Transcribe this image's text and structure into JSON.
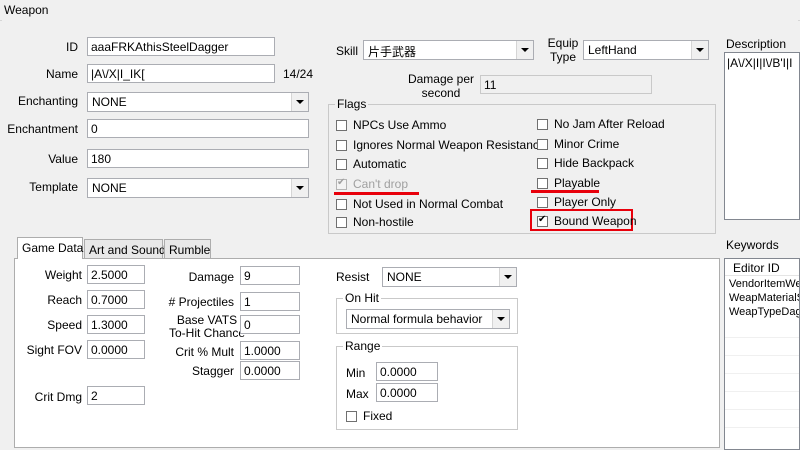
{
  "window": {
    "title": "Weapon"
  },
  "basic": {
    "id_label": "ID",
    "id_value": "aaaFRKAthisSteelDagger",
    "name_label": "Name",
    "name_value": "|A\\/X|I_IK[",
    "name_count": "14/24",
    "enchanting_label": "Enchanting",
    "enchanting_value": "NONE",
    "enchantment_label": "Enchantment",
    "enchantment_value": "0",
    "value_label": "Value",
    "value_value": "180",
    "template_label": "Template",
    "template_value": "NONE"
  },
  "skill": {
    "label": "Skill",
    "value": "片手武器"
  },
  "equip": {
    "label_line1": "Equip",
    "label_line2": "Type",
    "value": "LeftHand"
  },
  "damage_per_second": {
    "label_line1": "Damage per",
    "label_line2": "second",
    "value": "11"
  },
  "flags": {
    "title": "Flags",
    "left": [
      {
        "label": "NPCs Use Ammo",
        "checked": false,
        "disabled": false
      },
      {
        "label": "Ignores Normal Weapon Resistance",
        "checked": false,
        "disabled": false
      },
      {
        "label": "Automatic",
        "checked": false,
        "disabled": false
      },
      {
        "label": "Can't drop",
        "checked": true,
        "disabled": true
      },
      {
        "label": "Not Used in Normal Combat",
        "checked": false,
        "disabled": false
      },
      {
        "label": "Non-hostile",
        "checked": false,
        "disabled": false
      }
    ],
    "right": [
      {
        "label": "No Jam After Reload",
        "checked": false,
        "disabled": false
      },
      {
        "label": "Minor Crime",
        "checked": false,
        "disabled": false
      },
      {
        "label": "Hide Backpack",
        "checked": false,
        "disabled": false
      },
      {
        "label": "Playable",
        "checked": false,
        "disabled": false
      },
      {
        "label": "Player Only",
        "checked": false,
        "disabled": false
      },
      {
        "label": "Bound Weapon",
        "checked": true,
        "disabled": false
      }
    ]
  },
  "description": {
    "label": "Description",
    "value": "|A\\/X|I|I\\/B'I|I"
  },
  "keywords": {
    "label": "Keywords",
    "column": "Editor ID",
    "rows": [
      "VendorItemWe",
      "WeapMaterialS",
      "WeapTypeDag"
    ]
  },
  "tabs": [
    "Game Data",
    "Art and Sound",
    "Rumble"
  ],
  "game_data": {
    "weight_label": "Weight",
    "weight_value": "2.5000",
    "reach_label": "Reach",
    "reach_value": "0.7000",
    "speed_label": "Speed",
    "speed_value": "1.3000",
    "sightfov_label": "Sight FOV",
    "sightfov_value": "0.0000",
    "critdmg_label": "Crit Dmg",
    "critdmg_value": "2",
    "damage_label": "Damage",
    "damage_value": "9",
    "projectiles_label": "# Projectiles",
    "projectiles_value": "1",
    "vats_label_line1": "Base VATS",
    "vats_label_line2": "To-Hit Chance",
    "vats_value": "0",
    "critmult_label": "Crit % Mult",
    "critmult_value": "1.0000",
    "stagger_label": "Stagger",
    "stagger_value": "0.0000",
    "resist_label": "Resist",
    "resist_value": "NONE",
    "onhit_title": "On Hit",
    "onhit_value": "Normal formula behavior",
    "range_title": "Range",
    "min_label": "Min",
    "min_value": "0.0000",
    "max_label": "Max",
    "max_value": "0.0000",
    "fixed_label": "Fixed",
    "fixed_checked": false
  },
  "colors": {
    "highlight": "#e8000b",
    "window_bg": "#f0f0f0"
  }
}
